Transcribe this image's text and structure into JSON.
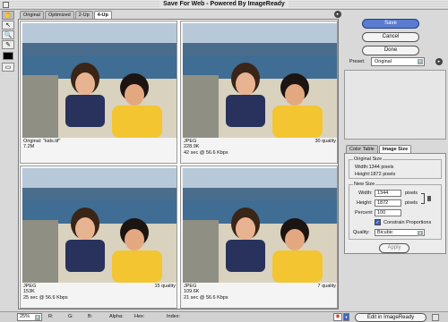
{
  "window": {
    "title": "Save For Web - Powered By ImageReady"
  },
  "tabs": [
    "Original",
    "Optimized",
    "2-Up",
    "4-Up"
  ],
  "active_tab": "4-Up",
  "panes": [
    {
      "line1": "Original: \"kids.tif\"",
      "line2": "7.2M",
      "line3": "",
      "quality": ""
    },
    {
      "line1": "JPEG",
      "line2": "228.9K",
      "line3": "42 sec @ 56.6 Kbps",
      "quality": "30 quality"
    },
    {
      "line1": "JPEG",
      "line2": "153K",
      "line3": "25 sec @ 56.6 Kbps",
      "quality": "15 quality"
    },
    {
      "line1": "JPEG",
      "line2": "109.6K",
      "line3": "21 sec @ 56.6 Kbps",
      "quality": "7 quality"
    }
  ],
  "buttons": {
    "save": "Save",
    "cancel": "Cancel",
    "done": "Done",
    "apply": "Apply",
    "edit": "Edit in ImageReady"
  },
  "preset": {
    "label": "Preset:",
    "value": "Original"
  },
  "image_size_tabs": [
    "Color Table",
    "Image Size"
  ],
  "original_size": {
    "label": "Original Size",
    "width": "Width:1344 pixels",
    "height": "Height:1872 pixels"
  },
  "new_size": {
    "label": "New Size",
    "width_label": "Width:",
    "width_value": "1344",
    "width_unit": "pixels",
    "height_label": "Height:",
    "height_value": "1872",
    "height_unit": "pixels",
    "percent_label": "Percent:",
    "percent_value": "100",
    "constrain_label": "Constrain Proportions",
    "quality_label": "Quality:",
    "quality_value": "Bicubic"
  },
  "status": {
    "zoom": "25%",
    "r": "R:",
    "g": "G:",
    "b": "B:",
    "alpha": "Alpha:",
    "hex": "Hex:",
    "index": "Index:"
  },
  "colors": {
    "sky": "#9db6cc",
    "water": "#3f6d93",
    "shirt_yellow": "#f3c531",
    "shirt_navy": "#28325d",
    "primary_button": "#5a7bd0"
  }
}
